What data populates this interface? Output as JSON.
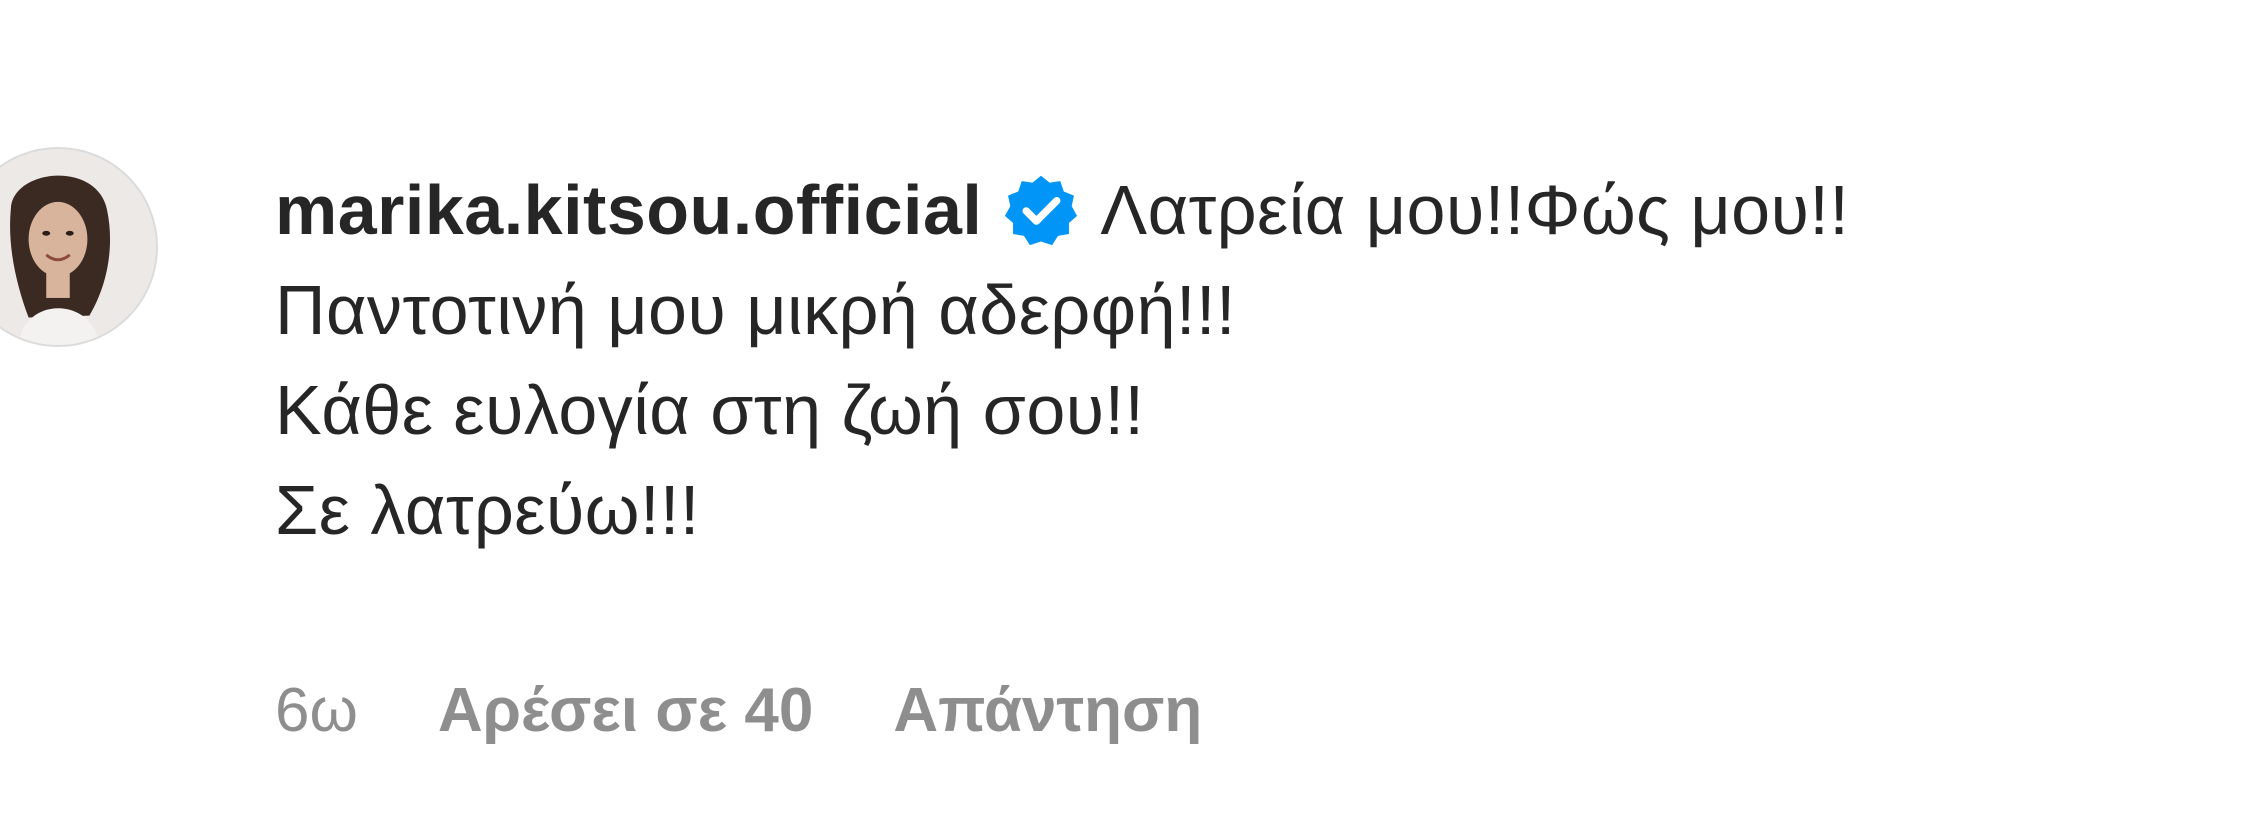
{
  "comment": {
    "username": "marika.kitsou.official",
    "verified_icon": "verified-badge-icon",
    "text_first": "Λατρεία μου!!Φώς μου!!",
    "lines": [
      "Παντοτινή μου μικρή αδερφή!!!",
      "Κάθε ευλογία στη ζωή σου!!",
      "Σε λατρεύω!!!"
    ],
    "time": "6ω",
    "likes": "Αρέσει σε 40",
    "reply": "Απάντηση"
  },
  "colors": {
    "text": "#262626",
    "meta": "#8e8e8e",
    "verified": "#0095f6"
  }
}
